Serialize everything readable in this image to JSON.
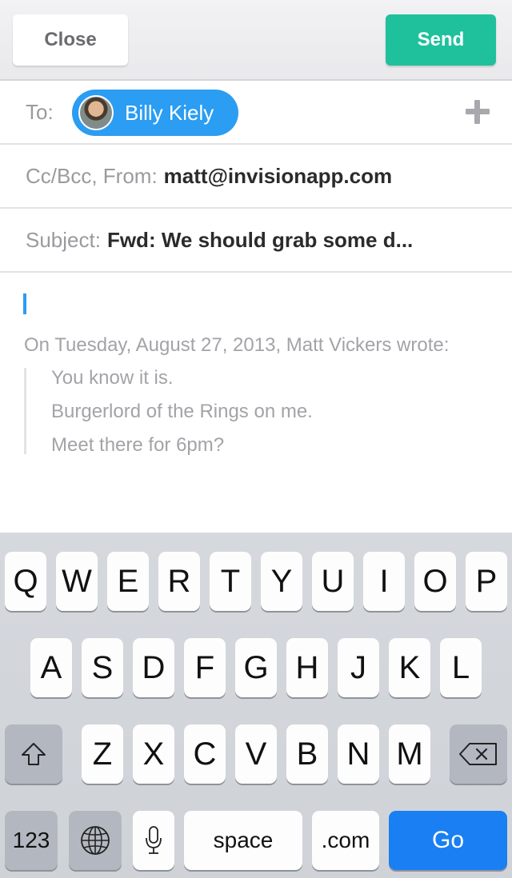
{
  "toolbar": {
    "close_label": "Close",
    "send_label": "Send"
  },
  "to": {
    "label": "To:",
    "recipient": "Billy Kiely"
  },
  "cc": {
    "label": "Cc/Bcc, From:",
    "value": "matt@invisionapp.com"
  },
  "subject": {
    "label": "Subject:",
    "value": "Fwd: We should grab some d..."
  },
  "body": {
    "quote_intro": "On Tuesday, August 27, 2013, Matt Vickers wrote:",
    "quote_lines": [
      "You know it is.",
      "Burgerlord of the Rings on me.",
      "Meet there for 6pm?"
    ]
  },
  "keyboard": {
    "row1": [
      "Q",
      "W",
      "E",
      "R",
      "T",
      "Y",
      "U",
      "I",
      "O",
      "P"
    ],
    "row2": [
      "A",
      "S",
      "D",
      "F",
      "G",
      "H",
      "J",
      "K",
      "L"
    ],
    "row3": [
      "Z",
      "X",
      "C",
      "V",
      "B",
      "N",
      "M"
    ],
    "numbers_label": "123",
    "space_label": "space",
    "dotcom_label": ".com",
    "go_label": "Go"
  },
  "colors": {
    "send": "#1fc19d",
    "chip": "#2b9df2",
    "go": "#1a7ff2",
    "cursor": "#2b9df2"
  }
}
